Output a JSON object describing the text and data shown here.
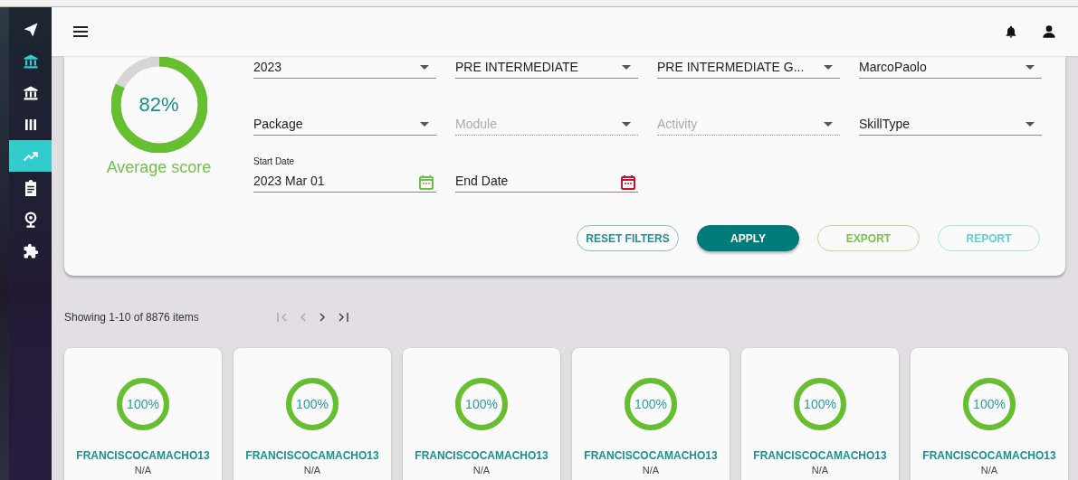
{
  "sidebar": {
    "items": [
      {
        "selected": false,
        "highlighted": false
      },
      {
        "selected": false,
        "highlighted": true
      },
      {
        "selected": false,
        "highlighted": false
      },
      {
        "selected": false,
        "highlighted": false
      },
      {
        "selected": true,
        "highlighted": false
      },
      {
        "selected": false,
        "highlighted": false
      },
      {
        "selected": false,
        "highlighted": false
      },
      {
        "selected": false,
        "highlighted": false
      }
    ]
  },
  "summary": {
    "level": 0.82,
    "percent": "82%",
    "label": "Average score"
  },
  "filters": [
    {
      "kind": "select",
      "value": "2023",
      "disabled": false
    },
    {
      "kind": "select",
      "value": "PRE INTERMEDIATE",
      "disabled": false
    },
    {
      "kind": "select",
      "value": "PRE INTERMEDIATE G...",
      "disabled": false
    },
    {
      "kind": "select",
      "value": "MarcoPaolo",
      "disabled": false
    },
    {
      "kind": "select",
      "placeholder": "Package",
      "disabled": false
    },
    {
      "kind": "select",
      "placeholder": "Module",
      "disabled": true
    },
    {
      "kind": "select",
      "placeholder": "Activity",
      "disabled": true
    },
    {
      "kind": "select",
      "placeholder": "SkillType",
      "disabled": false
    },
    {
      "kind": "date",
      "label": "Start Date",
      "value": "2023 Mar 01",
      "color": "#6cc04a"
    },
    {
      "kind": "date",
      "placeholder": "End Date",
      "color": "#c8102e"
    }
  ],
  "buttons": [
    {
      "label": "RESET FILTERS",
      "kind": "outline",
      "color": "#2a8c8c"
    },
    {
      "label": "APPLY",
      "kind": "filled",
      "color": "#007b7a"
    },
    {
      "label": "EXPORT",
      "kind": "outline",
      "color": "#7cc04a"
    },
    {
      "label": "REPORT",
      "kind": "outline",
      "color": "#5fcfd8"
    }
  ],
  "pager": {
    "summary": "Showing 1-10 of 8876 items"
  },
  "cards": [
    {
      "percent": "100%",
      "level": 1,
      "name": "FRANCISCOCAMACHO13",
      "detail": "N/A"
    },
    {
      "percent": "100%",
      "level": 1,
      "name": "FRANCISCOCAMACHO13",
      "detail": "N/A"
    },
    {
      "percent": "100%",
      "level": 1,
      "name": "FRANCISCOCAMACHO13",
      "detail": "N/A"
    },
    {
      "percent": "100%",
      "level": 1,
      "name": "FRANCISCOCAMACHO13",
      "detail": "N/A"
    },
    {
      "percent": "100%",
      "level": 1,
      "name": "FRANCISCOCAMACHO13",
      "detail": "N/A"
    },
    {
      "percent": "100%",
      "level": 1,
      "name": "FRANCISCOCAMACHO13",
      "detail": "N/A"
    }
  ]
}
